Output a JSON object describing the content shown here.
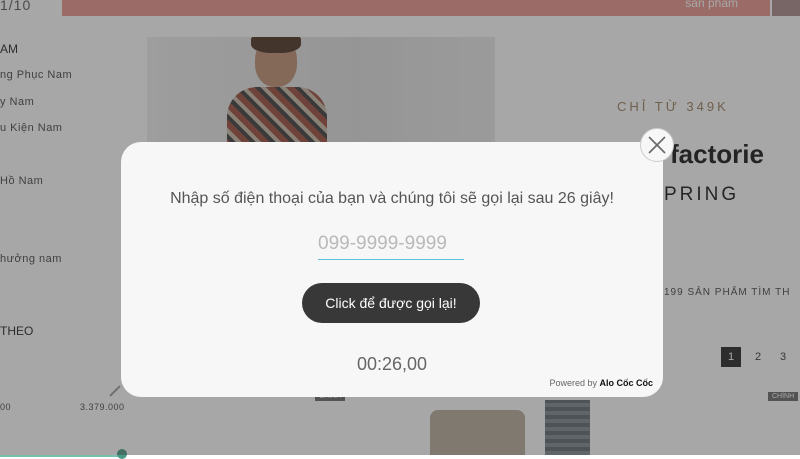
{
  "background": {
    "top_bar": {
      "date_fragment": "1/10",
      "banner_text": "sản phẩm"
    },
    "sidebar": {
      "category_title": "AM",
      "items": [
        "ng Phục Nam",
        "y Nam",
        "u Kiện Nam",
        "Hồ Nam",
        "hưởng nam"
      ],
      "sort_title": "THEO",
      "price_min": "00",
      "price_max": "3.379.000"
    },
    "promo": {
      "subtitle": "CHỈ TỪ 349K",
      "brand": "factorie",
      "season": "PRING",
      "count_text": "199 SẢN PHẨM TÌM TH"
    },
    "pagination": [
      "1",
      "2",
      "3"
    ],
    "product_tags": [
      "CHÍNH",
      "CHÍNH"
    ]
  },
  "popup": {
    "message": "Nhập số điện thoại của bạn và chúng tôi sẽ gọi lại sau 26 giây!",
    "phone_placeholder": "099-9999-9999",
    "phone_value": "",
    "call_button_label": "Click để được gọi lại!",
    "timer": "00:26,00",
    "powered_prefix": "Powered by",
    "powered_brand": "Alo Cốc Cốc",
    "close_icon": "close-icon"
  },
  "colors": {
    "overlay": "rgba(60,60,60,0.45)",
    "button_bg": "#383838",
    "input_underline": "#5bc0de",
    "banner": "#e8938a"
  }
}
